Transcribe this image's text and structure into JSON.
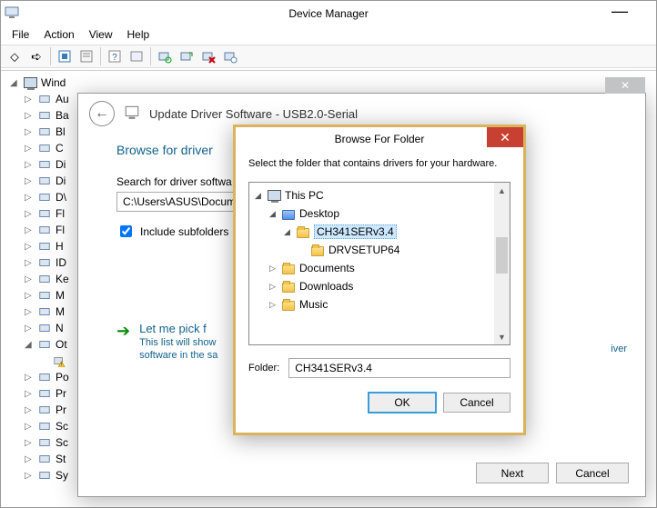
{
  "dm": {
    "title": "Device Manager",
    "menus": [
      "File",
      "Action",
      "View",
      "Help"
    ],
    "root": "Wind",
    "devices": [
      {
        "label": "Au",
        "exp": "▷"
      },
      {
        "label": "Ba",
        "exp": "▷"
      },
      {
        "label": "Bl",
        "exp": "▷"
      },
      {
        "label": "C",
        "exp": "▷"
      },
      {
        "label": "Di",
        "exp": "▷"
      },
      {
        "label": "Di",
        "exp": "▷"
      },
      {
        "label": "D\\",
        "exp": "▷"
      },
      {
        "label": "Fl",
        "exp": "▷"
      },
      {
        "label": "Fl",
        "exp": "▷"
      },
      {
        "label": "H",
        "exp": "▷"
      },
      {
        "label": "ID",
        "exp": "▷"
      },
      {
        "label": "Ke",
        "exp": "▷"
      },
      {
        "label": "M",
        "exp": "▷"
      },
      {
        "label": "M",
        "exp": "▷"
      },
      {
        "label": "N",
        "exp": "▷"
      },
      {
        "label": "Ot",
        "exp": "◢"
      },
      {
        "label": "",
        "exp": "",
        "warn": true
      },
      {
        "label": "Po",
        "exp": "▷"
      },
      {
        "label": "Pr",
        "exp": "▷"
      },
      {
        "label": "Pr",
        "exp": "▷"
      },
      {
        "label": "Sc",
        "exp": "▷"
      },
      {
        "label": "Sc",
        "exp": "▷"
      },
      {
        "label": "St",
        "exp": "▷"
      },
      {
        "label": "Sy",
        "exp": "▷"
      }
    ]
  },
  "wizard": {
    "title": "Update Driver Software - USB2.0-Serial",
    "h1": "Browse for driver",
    "search_label": "Search for driver softwa",
    "path": "C:\\Users\\ASUS\\Docum",
    "include_label": "Include subfolders",
    "include_checked": true,
    "pick_title": "Let me pick f",
    "pick_desc1": "This list will show",
    "pick_desc2": "software in the sa",
    "river_text": "iver",
    "next": "Next",
    "cancel": "Cancel"
  },
  "bff": {
    "title": "Browse For Folder",
    "instruction": "Select the folder that contains drivers for your hardware.",
    "tree": {
      "root": "This PC",
      "desktop": "Desktop",
      "selected": "CH341SERv3.4",
      "child": "DRVSETUP64",
      "documents": "Documents",
      "downloads": "Downloads",
      "music": "Music"
    },
    "folder_label": "Folder:",
    "folder_value": "CH341SERv3.4",
    "ok": "OK",
    "cancel": "Cancel"
  }
}
